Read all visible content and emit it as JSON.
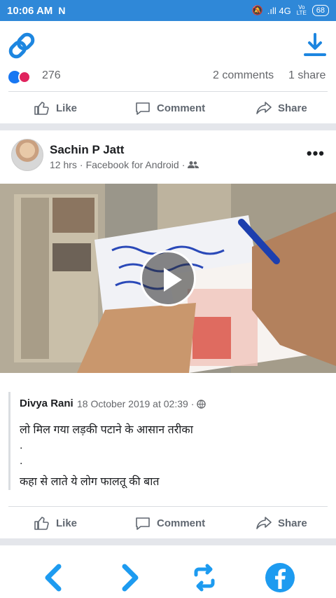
{
  "status_bar": {
    "time": "10:06 AM",
    "notification_icon": "N",
    "network": ".ıll 4G",
    "volte": "Vo LTE",
    "battery": "68"
  },
  "toolbar": {
    "link_icon": "link-icon",
    "download_icon": "download-icon"
  },
  "reactions": {
    "count": "276",
    "comments": "2 comments",
    "shares": "1 share"
  },
  "actions": {
    "like": "Like",
    "comment": "Comment",
    "share": "Share"
  },
  "post": {
    "author": "Sachin P Jatt",
    "time": "12 hrs",
    "separator": "·",
    "source": "Facebook for Android",
    "separator2": "·",
    "more": "•••"
  },
  "comment": {
    "author": "Divya Rani",
    "date": "18 October 2019 at 02:39",
    "separator": "·",
    "line1": "लो मिल गया लड़की पटाने के आसान तरीका",
    "dot1": ".",
    "dot2": ".",
    "line2": "कहा से लाते ये लोग फालतू की बात"
  },
  "colors": {
    "accent": "#1877f2",
    "status_bar": "#2f88d8",
    "nav_blue": "#1d9bf0"
  }
}
